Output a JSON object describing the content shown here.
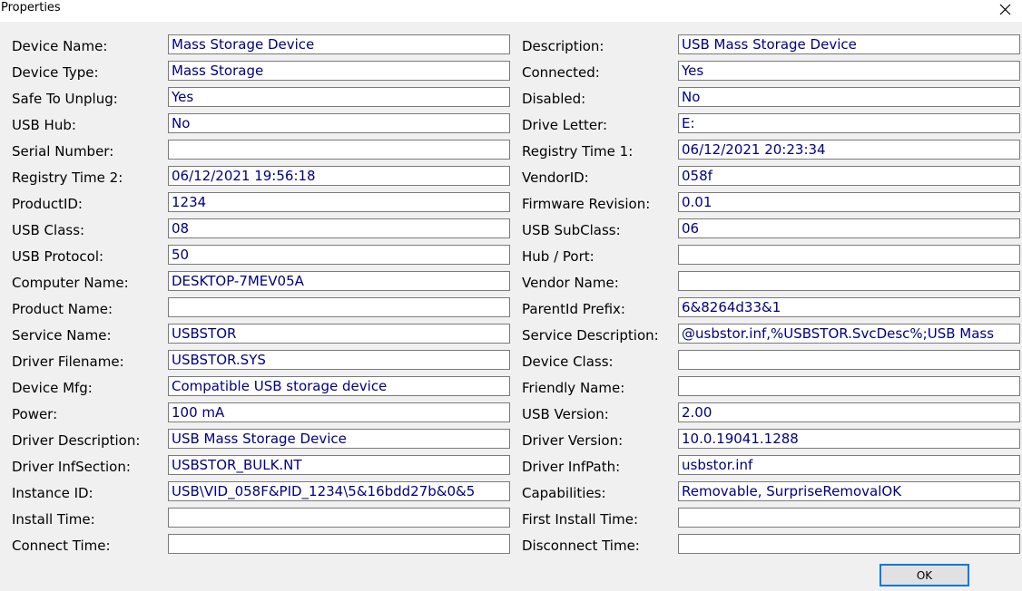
{
  "window": {
    "title": "Properties",
    "ok_label": "OK"
  },
  "rows": [
    {
      "left": {
        "label": "Device Name:",
        "value": "Mass Storage Device"
      },
      "right": {
        "label": "Description:",
        "value": "USB Mass Storage Device"
      }
    },
    {
      "left": {
        "label": "Device Type:",
        "value": "Mass Storage"
      },
      "right": {
        "label": "Connected:",
        "value": "Yes"
      }
    },
    {
      "left": {
        "label": "Safe To Unplug:",
        "value": "Yes"
      },
      "right": {
        "label": "Disabled:",
        "value": "No"
      }
    },
    {
      "left": {
        "label": "USB Hub:",
        "value": "No"
      },
      "right": {
        "label": "Drive Letter:",
        "value": "E:"
      }
    },
    {
      "left": {
        "label": "Serial Number:",
        "value": ""
      },
      "right": {
        "label": "Registry Time 1:",
        "value": "06/12/2021 20:23:34"
      }
    },
    {
      "left": {
        "label": "Registry Time 2:",
        "value": "06/12/2021 19:56:18"
      },
      "right": {
        "label": "VendorID:",
        "value": "058f"
      }
    },
    {
      "left": {
        "label": "ProductID:",
        "value": "1234"
      },
      "right": {
        "label": "Firmware Revision:",
        "value": "0.01"
      }
    },
    {
      "left": {
        "label": "USB Class:",
        "value": "08"
      },
      "right": {
        "label": "USB SubClass:",
        "value": "06"
      }
    },
    {
      "left": {
        "label": "USB Protocol:",
        "value": "50"
      },
      "right": {
        "label": "Hub / Port:",
        "value": ""
      }
    },
    {
      "left": {
        "label": "Computer Name:",
        "value": "DESKTOP-7MEV05A"
      },
      "right": {
        "label": "Vendor Name:",
        "value": ""
      }
    },
    {
      "left": {
        "label": "Product Name:",
        "value": ""
      },
      "right": {
        "label": "ParentId Prefix:",
        "value": "6&8264d33&1"
      }
    },
    {
      "left": {
        "label": "Service Name:",
        "value": "USBSTOR"
      },
      "right": {
        "label": "Service Description:",
        "value": "@usbstor.inf,%USBSTOR.SvcDesc%;USB Mass"
      }
    },
    {
      "left": {
        "label": "Driver Filename:",
        "value": "USBSTOR.SYS"
      },
      "right": {
        "label": "Device Class:",
        "value": ""
      }
    },
    {
      "left": {
        "label": "Device Mfg:",
        "value": "Compatible USB storage device"
      },
      "right": {
        "label": "Friendly Name:",
        "value": ""
      }
    },
    {
      "left": {
        "label": "Power:",
        "value": "100 mA"
      },
      "right": {
        "label": "USB Version:",
        "value": "2.00"
      }
    },
    {
      "left": {
        "label": "Driver Description:",
        "value": "USB Mass Storage Device"
      },
      "right": {
        "label": "Driver Version:",
        "value": "10.0.19041.1288"
      }
    },
    {
      "left": {
        "label": "Driver InfSection:",
        "value": "USBSTOR_BULK.NT"
      },
      "right": {
        "label": "Driver InfPath:",
        "value": "usbstor.inf"
      }
    },
    {
      "left": {
        "label": "Instance ID:",
        "value": "USB\\VID_058F&PID_1234\\5&16bdd27b&0&5"
      },
      "right": {
        "label": "Capabilities:",
        "value": "Removable, SurpriseRemovalOK"
      }
    },
    {
      "left": {
        "label": "Install Time:",
        "value": ""
      },
      "right": {
        "label": "First Install Time:",
        "value": ""
      }
    },
    {
      "left": {
        "label": "Connect Time:",
        "value": ""
      },
      "right": {
        "label": "Disconnect Time:",
        "value": ""
      }
    }
  ]
}
